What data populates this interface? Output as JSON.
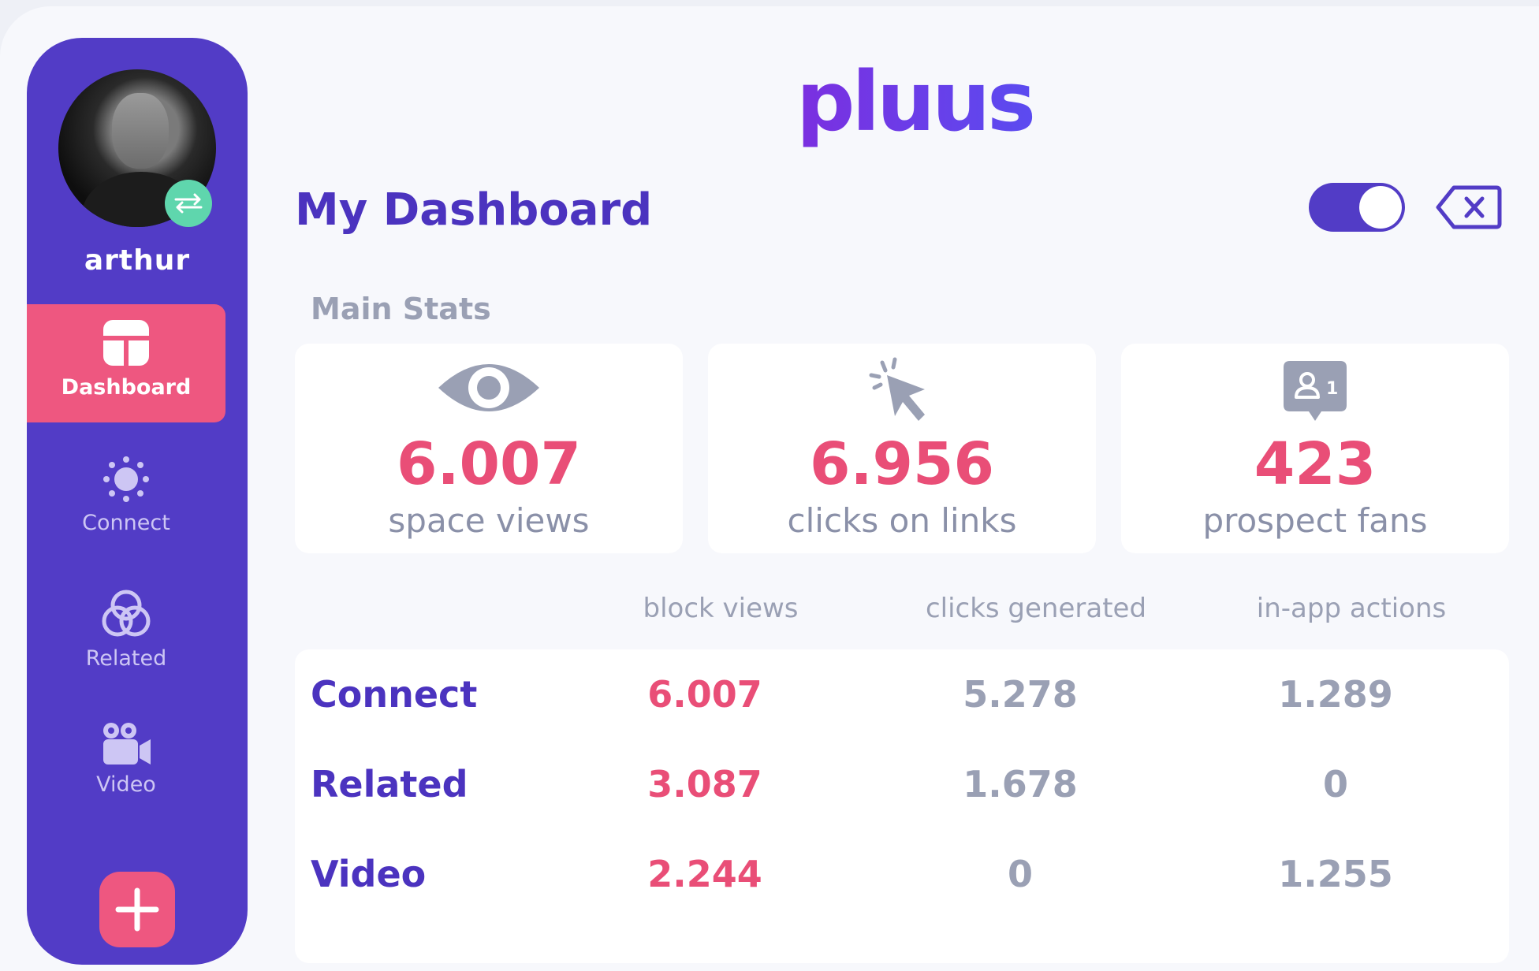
{
  "app": {
    "logo": "pluus"
  },
  "user": {
    "name": "arthur"
  },
  "sidebar": {
    "items": [
      {
        "label": "Dashboard",
        "icon": "dashboard-icon"
      },
      {
        "label": "Connect",
        "icon": "sun-icon"
      },
      {
        "label": "Related",
        "icon": "circles-icon"
      },
      {
        "label": "Video",
        "icon": "video-camera-icon"
      }
    ],
    "add_icon": "plus-icon"
  },
  "header": {
    "title": "My Dashboard",
    "toggle_on": true
  },
  "main_stats": {
    "label": "Main Stats",
    "cards": [
      {
        "value": "6.007",
        "caption": "space views",
        "icon": "eye-icon"
      },
      {
        "value": "6.956",
        "caption": "clicks on links",
        "icon": "cursor-click-icon"
      },
      {
        "value": "423",
        "caption": "prospect fans",
        "icon": "user-badge-icon",
        "badge": "1"
      }
    ]
  },
  "table": {
    "columns": [
      "block views",
      "clicks generated",
      "in-app actions"
    ],
    "rows": [
      {
        "label": "Connect",
        "values": [
          "6.007",
          "5.278",
          "1.289"
        ]
      },
      {
        "label": "Related",
        "values": [
          "3.087",
          "1.678",
          "0"
        ]
      },
      {
        "label": "Video",
        "values": [
          "2.244",
          "0",
          "1.255"
        ]
      }
    ]
  },
  "colors": {
    "primary": "#523cc6",
    "accent": "#ee5780",
    "muted": "#9aa0b4"
  }
}
